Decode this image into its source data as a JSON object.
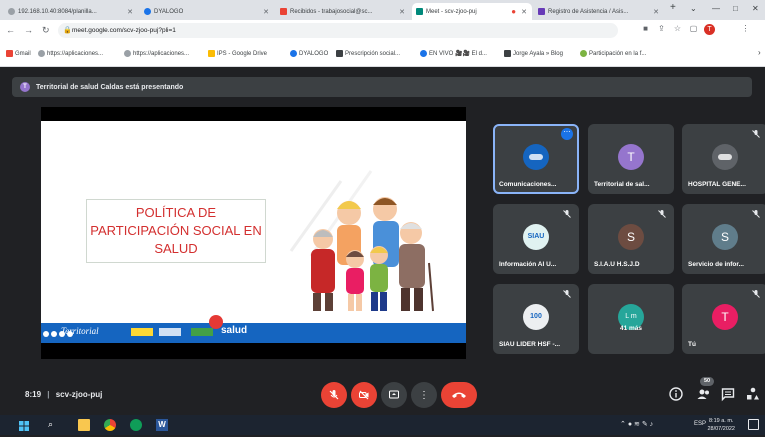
{
  "browser": {
    "tabs": [
      {
        "label": "192.168.10.40:8084/planilla..."
      },
      {
        "label": "DYALOGO"
      },
      {
        "label": "Recibidos - trabajosocial@sc..."
      },
      {
        "label": "Meet - scv-zjoo-puj"
      },
      {
        "label": "Registro de Asistencia / Asis..."
      }
    ],
    "new_tab": "+",
    "url": "meet.google.com/scv-zjoo-puj?pli=1"
  },
  "bookmarks": [
    {
      "label": "Gmail"
    },
    {
      "label": "https://aplicaciones..."
    },
    {
      "label": "https://aplicaciones..."
    },
    {
      "label": "IPS - Google Drive"
    },
    {
      "label": "DYALOGO"
    },
    {
      "label": "Prescripción social..."
    },
    {
      "label": "EN VIVO 🎥🎥 El d..."
    },
    {
      "label": "Jorge Ayala » Blog"
    },
    {
      "label": "Participación en la f..."
    }
  ],
  "presenting": {
    "avatar": "T",
    "text": "Territorial de salud Caldas está presentando"
  },
  "slide": {
    "title": "POLÍTICA DE PARTICIPACIÓN SOCIAL EN SALUD",
    "footer_brand": "Territorial",
    "footer_right": "salud"
  },
  "participants": [
    {
      "name": "Comunicaciones...",
      "avatar": "",
      "color": "#1565c0",
      "muted": false,
      "active": true
    },
    {
      "name": "Territorial de sal...",
      "avatar": "T",
      "color": "#9575cd",
      "muted": false,
      "active": false
    },
    {
      "name": "HOSPITAL GENE...",
      "avatar": "",
      "color": "#5f6368",
      "muted": true,
      "active": false
    },
    {
      "name": "Información Al U...",
      "avatar": "SIAU",
      "color": "#e0f2f1",
      "muted": true,
      "active": false
    },
    {
      "name": "S.I.A.U H.S.J.D",
      "avatar": "S",
      "color": "#6d4c41",
      "muted": true,
      "active": false
    },
    {
      "name": "Servicio de infor...",
      "avatar": "S",
      "color": "#607d8b",
      "muted": true,
      "active": false
    },
    {
      "name": "SIAU LIDER HSF -...",
      "avatar": "100",
      "color": "#eceff1",
      "muted": true,
      "active": false
    },
    {
      "name": "41 más",
      "avatar": "L m",
      "color": "#26a69a",
      "muted": false,
      "active": false
    },
    {
      "name": "Tú",
      "avatar": "T",
      "color": "#e91e63",
      "muted": true,
      "active": false
    }
  ],
  "bottom": {
    "time": "8:19",
    "meeting_code": "scv-zjoo-puj",
    "people_count": "50"
  },
  "taskbar": {
    "lang": "ESP",
    "time": "8:19 a. m.",
    "date": "28/07/2022"
  }
}
